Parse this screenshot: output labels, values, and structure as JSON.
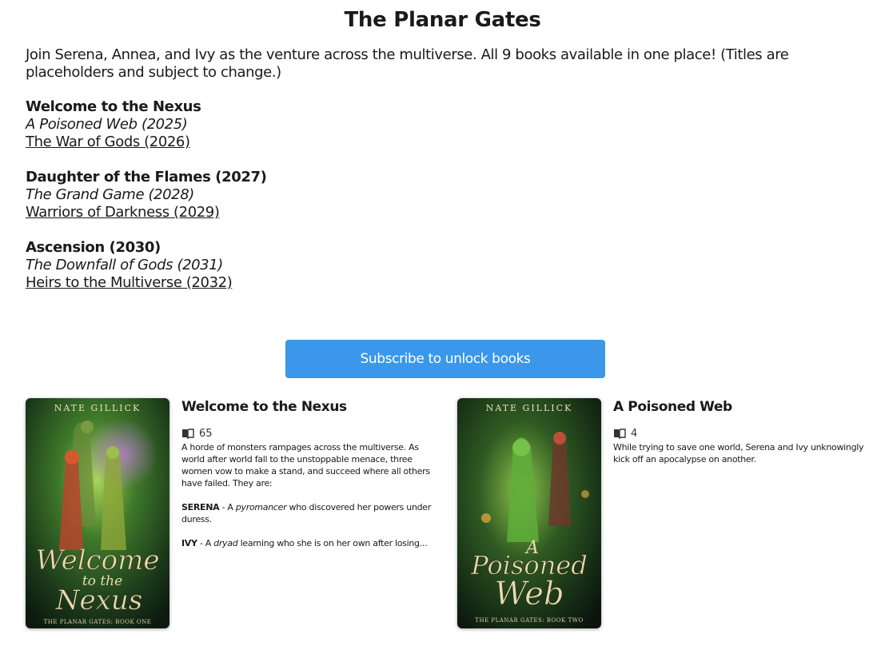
{
  "page": {
    "title": "The Planar Gates",
    "intro": "Join Serena, Annea, and Ivy as the venture across the multiverse. All 9 books available in one place! (Titles are placeholders and subject to change.)"
  },
  "book_groups": [
    {
      "bold": "Welcome to the Nexus",
      "italic": "A Poisoned Web (2025)",
      "link": "The War of Gods (2026)"
    },
    {
      "bold": "Daughter of the Flames (2027)",
      "italic": "The Grand Game (2028)",
      "link": "Warriors of Darkness (2029)"
    },
    {
      "bold": "Ascension (2030)",
      "italic": "The Downfall of Gods (2031)",
      "link": "Heirs to the Multiverse (2032)"
    }
  ],
  "subscribe_label": "Subscribe to unlock books",
  "cards": [
    {
      "title": "Welcome to the Nexus",
      "reader_count": "65",
      "cover_author": "NATE GILLICK",
      "cover_title_1": "Welcome",
      "cover_title_2": "to the",
      "cover_title_3": "Nexus",
      "cover_series": "THE PLANAR GATES: BOOK ONE",
      "desc_1": "A horde of monsters rampages across the multiverse. As world after world fall to the unstoppable menace, three women vow to make a stand, and succeed where all others have failed. They are:",
      "serena_name": "SERENA",
      "serena_pre": " - A ",
      "serena_role": "pyromancer",
      "serena_post": " who discovered her powers under duress.",
      "ivy_name": "IVY",
      "ivy_pre": " - A ",
      "ivy_role": "dryad",
      "ivy_post": " learning who she is on her own after losing..."
    },
    {
      "title": "A Poisoned Web",
      "reader_count": "4",
      "cover_author": "NATE GILLICK",
      "cover_title_1": "A",
      "cover_title_2": "Poisoned",
      "cover_title_3": "Web",
      "cover_series": "THE PLANAR GATES: BOOK TWO",
      "desc_1": "While trying to save one world, Serena and Ivy unknowingly kick off an apocalypse on another."
    }
  ],
  "colors": {
    "accent": "#3a97ea",
    "cover_green": "#2f5a22",
    "cover_gold": "#e6dcb0"
  },
  "icons": {
    "readers": "open-book-icon"
  }
}
